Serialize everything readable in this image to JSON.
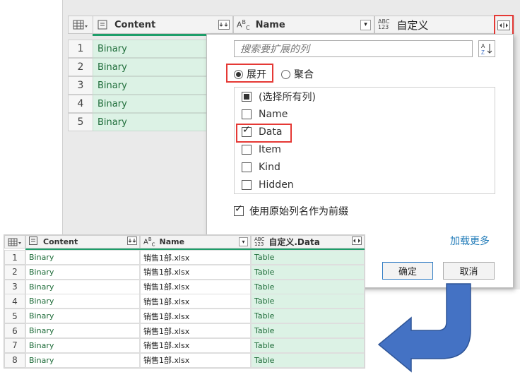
{
  "grid": {
    "columns": [
      {
        "type_icon": "table-icon",
        "label": "Content"
      },
      {
        "type_icon": "abc-icon",
        "label": "Name"
      },
      {
        "type_icon": "abc123-icon",
        "label": "自定义"
      }
    ],
    "type_abc": "ABC",
    "type_123": "123",
    "rows": [
      {
        "num": "1",
        "content": "Binary"
      },
      {
        "num": "2",
        "content": "Binary"
      },
      {
        "num": "3",
        "content": "Binary"
      },
      {
        "num": "4",
        "content": "Binary"
      },
      {
        "num": "5",
        "content": "Binary"
      }
    ]
  },
  "popup": {
    "search_placeholder": "搜索要扩展的列",
    "radio_expand": "展开",
    "radio_aggregate": "聚合",
    "items": [
      {
        "label": "(选择所有列)",
        "state": "partial"
      },
      {
        "label": "Name",
        "state": "unchecked"
      },
      {
        "label": "Data",
        "state": "checked"
      },
      {
        "label": "Item",
        "state": "unchecked"
      },
      {
        "label": "Kind",
        "state": "unchecked"
      },
      {
        "label": "Hidden",
        "state": "unchecked"
      }
    ],
    "prefix_label": "使用原始列名作为前缀",
    "load_more": "加载更多",
    "ok": "确定",
    "cancel": "取消"
  },
  "result": {
    "columns": [
      "Content",
      "Name",
      "自定义.Data"
    ],
    "rows": [
      {
        "num": "1",
        "content": "Binary",
        "name": "销售1部.xlsx",
        "data": "Table"
      },
      {
        "num": "2",
        "content": "Binary",
        "name": "销售1部.xlsx",
        "data": "Table"
      },
      {
        "num": "3",
        "content": "Binary",
        "name": "销售1部.xlsx",
        "data": "Table"
      },
      {
        "num": "4",
        "content": "Binary",
        "name": "销售1部.xlsx",
        "data": "Table"
      },
      {
        "num": "5",
        "content": "Binary",
        "name": "销售1部.xlsx",
        "data": "Table"
      },
      {
        "num": "6",
        "content": "Binary",
        "name": "销售1部.xlsx",
        "data": "Table"
      },
      {
        "num": "7",
        "content": "Binary",
        "name": "销售1部.xlsx",
        "data": "Table"
      },
      {
        "num": "8",
        "content": "Binary",
        "name": "销售1部.xlsx",
        "data": "Table"
      }
    ]
  },
  "colors": {
    "accent_green": "#1e9e6a",
    "highlight_red": "#e53935",
    "arrow_blue": "#4472c4"
  }
}
